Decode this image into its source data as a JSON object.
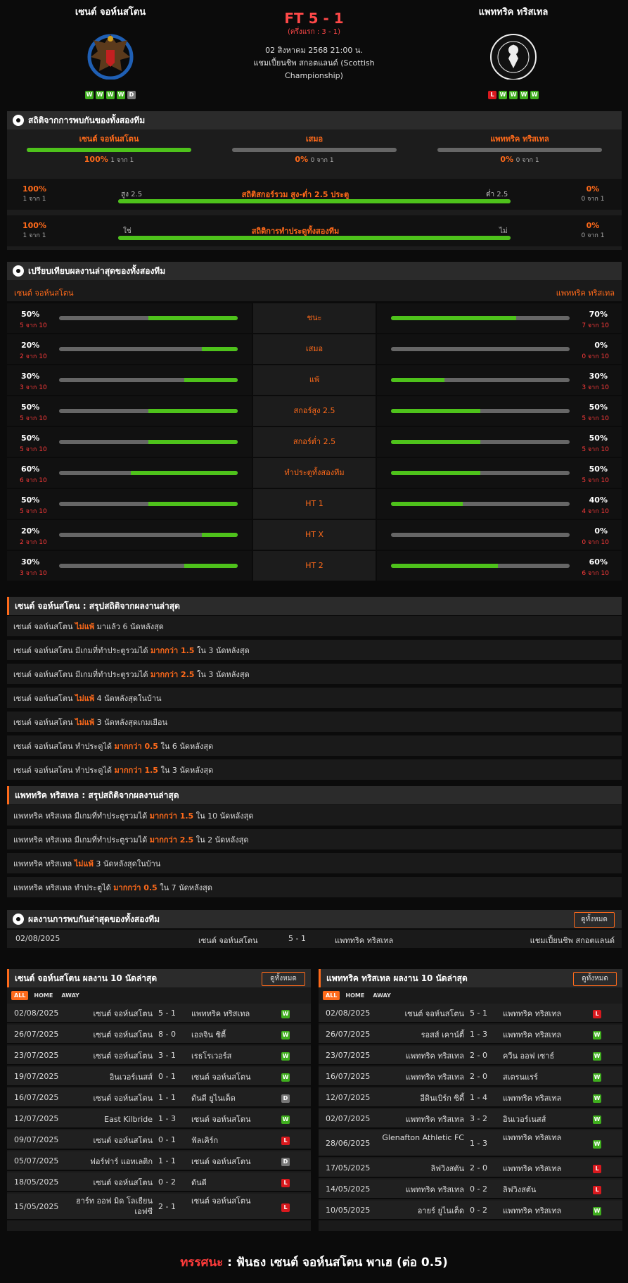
{
  "header": {
    "home": "เซนต์ จอห์นสโตน",
    "away": "แพททริค ทริสเทล",
    "score": "FT 5 - 1",
    "halftime": "(ครึ่งแรก : 3 - 1)",
    "date": "02 สิงหาคม 2568 21:00 น.",
    "league": "แชมเปี้ยนชิพ สกอตแลนด์ (Scottish",
    "league2": "Championship)",
    "home_form": [
      "W",
      "W",
      "W",
      "W",
      "D"
    ],
    "away_form": [
      "L",
      "W",
      "W",
      "W",
      "W"
    ],
    "home_logo_icon": "st-johnstone-crest-icon",
    "away_logo_icon": "partick-thistle-crest-icon"
  },
  "h2h": {
    "title": "สถิติจากการพบกันของทั้งสองทีม",
    "home_label": "เซนต์ จอห์นสโตน",
    "draw_label": "เสมอ",
    "away_label": "แพททริค ทริสเทล",
    "home_pct": "100%",
    "home_sub": "1 จาก 1",
    "draw_pct": "0%",
    "draw_sub": "0 จาก 1",
    "away_pct": "0%",
    "away_sub": "0 จาก 1",
    "home_frac": 1,
    "draw_frac": 0,
    "away_frac": 0,
    "ou": {
      "title": "สถิติสกอร์รวม สูง-ต่ำ 2.5 ประตู",
      "left": "สูง 2.5",
      "right": "ต่ำ 2.5",
      "lpct": "100%",
      "lsub": "1 จาก 1",
      "rpct": "0%",
      "rsub": "0 จาก 1",
      "frac": 1
    },
    "btts": {
      "title": "สถิติการทำประตูทั้งสองทีม",
      "left": "ใช่",
      "right": "ไม่",
      "lpct": "100%",
      "lsub": "1 จาก 1",
      "rpct": "0%",
      "rsub": "0 จาก 1",
      "frac": 1
    }
  },
  "compare": {
    "title": "เปรียบเทียบผลงานล่าสุดของทั้งสองทีม",
    "home": "เซนต์ จอห์นสโตน",
    "away": "แพททริค ทริสเทล",
    "rows": [
      {
        "label": "ชนะ",
        "hp": "50%",
        "hs": "5 จาก 10",
        "hf": 0.5,
        "ap": "70%",
        "as": "7 จาก 10",
        "af": 0.7
      },
      {
        "label": "เสมอ",
        "hp": "20%",
        "hs": "2 จาก 10",
        "hf": 0.2,
        "ap": "0%",
        "as": "0 จาก 10",
        "af": 0
      },
      {
        "label": "แพ้",
        "hp": "30%",
        "hs": "3 จาก 10",
        "hf": 0.3,
        "ap": "30%",
        "as": "3 จาก 10",
        "af": 0.3
      },
      {
        "label": "สกอร์สูง 2.5",
        "hp": "50%",
        "hs": "5 จาก 10",
        "hf": 0.5,
        "ap": "50%",
        "as": "5 จาก 10",
        "af": 0.5
      },
      {
        "label": "สกอร์ต่ำ 2.5",
        "hp": "50%",
        "hs": "5 จาก 10",
        "hf": 0.5,
        "ap": "50%",
        "as": "5 จาก 10",
        "af": 0.5
      },
      {
        "label": "ทำประตูทั้งสองทีม",
        "hp": "60%",
        "hs": "6 จาก 10",
        "hf": 0.6,
        "ap": "50%",
        "as": "5 จาก 10",
        "af": 0.5
      },
      {
        "label": "HT 1",
        "hp": "50%",
        "hs": "5 จาก 10",
        "hf": 0.5,
        "ap": "40%",
        "as": "4 จาก 10",
        "af": 0.4
      },
      {
        "label": "HT X",
        "hp": "20%",
        "hs": "2 จาก 10",
        "hf": 0.2,
        "ap": "0%",
        "as": "0 จาก 10",
        "af": 0
      },
      {
        "label": "HT 2",
        "hp": "30%",
        "hs": "3 จาก 10",
        "hf": 0.3,
        "ap": "60%",
        "as": "6 จาก 10",
        "af": 0.6
      }
    ]
  },
  "home_summary": {
    "title": "เซนต์ จอห์นสโตน : สรุปสถิติจากผลงานล่าสุด",
    "items": [
      [
        "เซนต์ จอห์นสโตน ",
        "ไม่แพ้",
        " มาแล้ว 6 นัดหลังสุด"
      ],
      [
        "เซนต์ จอห์นสโตน มีเกมที่ทำประตูรวมได้ ",
        "มากกว่า 1.5",
        " ใน 3 นัดหลังสุด"
      ],
      [
        "เซนต์ จอห์นสโตน มีเกมที่ทำประตูรวมได้ ",
        "มากกว่า 2.5",
        " ใน 3 นัดหลังสุด"
      ],
      [
        "เซนต์ จอห์นสโตน ",
        "ไม่แพ้",
        " 4 นัดหลังสุดในบ้าน"
      ],
      [
        "เซนต์ จอห์นสโตน ",
        "ไม่แพ้",
        " 3 นัดหลังสุดเกมเยือน"
      ],
      [
        "เซนต์ จอห์นสโตน ทำประตูได้ ",
        "มากกว่า 0.5",
        " ใน 6 นัดหลังสุด"
      ],
      [
        "เซนต์ จอห์นสโตน ทำประตูได้ ",
        "มากกว่า 1.5",
        " ใน 3 นัดหลังสุด"
      ]
    ]
  },
  "away_summary": {
    "title": "แพททริค ทริสเทล : สรุปสถิติจากผลงานล่าสุด",
    "items": [
      [
        "แพททริค ทริสเทล มีเกมที่ทำประตูรวมได้ ",
        "มากกว่า 1.5",
        " ใน 10 นัดหลังสุด"
      ],
      [
        "แพททริค ทริสเทล มีเกมที่ทำประตูรวมได้ ",
        "มากกว่า 2.5",
        " ใน 2 นัดหลังสุด"
      ],
      [
        "แพททริค ทริสเทล ",
        "ไม่แพ้",
        " 3 นัดหลังสุดในบ้าน"
      ],
      [
        "แพททริค ทริสเทล ทำประตูได้ ",
        "มากกว่า 0.5",
        " ใน 7 นัดหลังสุด"
      ]
    ]
  },
  "h2h_results": {
    "title": "ผลงานการพบกันล่าสุดของทั้งสองทีม",
    "view_all": "ดูทั้งหมด",
    "rows": [
      [
        "02/08/2025",
        "เซนต์ จอห์นสโตน",
        "5 - 1",
        "แพททริค ทริสเทล",
        "แชมเปี้ยนชิพ สกอตแลนด์"
      ]
    ]
  },
  "home_last10": {
    "title": "เซนต์ จอห์นสโตน ผลงาน 10 นัดล่าสุด",
    "view_all": "ดูทั้งหมด",
    "tabs": [
      "ALL",
      "HOME",
      "AWAY"
    ],
    "rows": [
      [
        "02/08/2025",
        "เซนต์ จอห์นสโตน",
        "5 - 1",
        "แพททริค ทริสเทล",
        "W"
      ],
      [
        "26/07/2025",
        "เซนต์ จอห์นสโตน",
        "8 - 0",
        "เอลจิน ซิตี้",
        "W"
      ],
      [
        "23/07/2025",
        "เซนต์ จอห์นสโตน",
        "3 - 1",
        "เรธโรเวอร์ส",
        "W"
      ],
      [
        "19/07/2025",
        "อินเวอร์เนสส์",
        "0 - 1",
        "เซนต์ จอห์นสโตน",
        "W"
      ],
      [
        "16/07/2025",
        "เซนต์ จอห์นสโตน",
        "1 - 1",
        "ดันดี ยูไนเต็ด",
        "D"
      ],
      [
        "12/07/2025",
        "East Kilbride",
        "1 - 3",
        "เซนต์ จอห์นสโตน",
        "W"
      ],
      [
        "09/07/2025",
        "เซนต์ จอห์นสโตน",
        "0 - 1",
        "ฟัลเคิร์ก",
        "L"
      ],
      [
        "05/07/2025",
        "ฟอร์ฟาร์ แอทเลติก",
        "1 - 1",
        "เซนต์ จอห์นสโตน",
        "D"
      ],
      [
        "18/05/2025",
        "เซนต์ จอห์นสโตน",
        "0 - 2",
        "ดันดี",
        "L"
      ],
      [
        "15/05/2025",
        "ฮาร์ท ออฟ มิด โลเธียน เอฟซี",
        "2 - 1",
        "เซนต์ จอห์นสโตน",
        "L"
      ]
    ]
  },
  "away_last10": {
    "title": "แพททริค ทริสเทล ผลงาน 10 นัดล่าสุด",
    "view_all": "ดูทั้งหมด",
    "tabs": [
      "ALL",
      "HOME",
      "AWAY"
    ],
    "rows": [
      [
        "02/08/2025",
        "เซนต์ จอห์นสโตน",
        "5 - 1",
        "แพททริค ทริสเทล",
        "L"
      ],
      [
        "26/07/2025",
        "รอสส์ เคาน์ตี้",
        "1 - 3",
        "แพททริค ทริสเทล",
        "W"
      ],
      [
        "23/07/2025",
        "แพททริค ทริสเทล",
        "2 - 0",
        "ควีน ออฟ เซาธ์",
        "W"
      ],
      [
        "16/07/2025",
        "แพททริค ทริสเทล",
        "2 - 0",
        "สเตรนแรร์",
        "W"
      ],
      [
        "12/07/2025",
        "อีดินเบิร์ก ซิตี้",
        "1 - 4",
        "แพททริค ทริสเทล",
        "W"
      ],
      [
        "02/07/2025",
        "แพททริค ทริสเทล",
        "3 - 2",
        "อินเวอร์เนสส์",
        "W"
      ],
      [
        "28/06/2025",
        "Glenafton Athletic FC",
        "1 - 3",
        "แพททริค ทริสเทล",
        "W"
      ],
      [
        "17/05/2025",
        "ลิฟวิงสตัน",
        "2 - 0",
        "แพททริค ทริสเทล",
        "L"
      ],
      [
        "14/05/2025",
        "แพททริค ทริสเทล",
        "0 - 2",
        "ลิฟวิงสตัน",
        "L"
      ],
      [
        "10/05/2025",
        "อายร์ ยูไนเต็ด",
        "0 - 2",
        "แพททริค ทริสเทล",
        "W"
      ]
    ]
  },
  "prediction": {
    "label": "ทรรศนะ",
    "colon": " : ",
    "text": "ฟันธง เซนต์ จอห์นสโตน พาเฮ (ต่อ 0.5)"
  },
  "colors": {
    "accent": "#ff6a1a",
    "win": "#3fae1e",
    "loss": "#d9191e",
    "draw": "#777777",
    "bar_fill": "#4ec21b"
  }
}
